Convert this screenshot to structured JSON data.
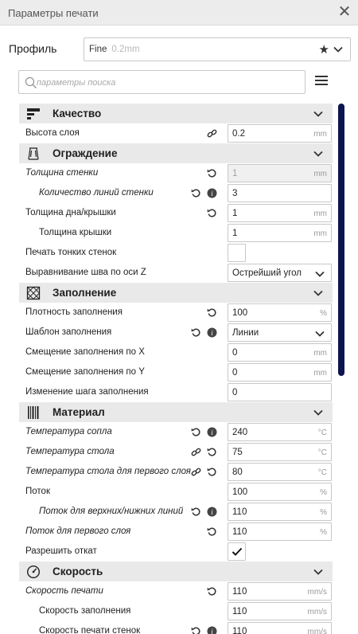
{
  "window": {
    "title": "Параметры печати"
  },
  "profile": {
    "label": "Профиль",
    "name": "Fine",
    "value": "0.2mm"
  },
  "search": {
    "placeholder": "параметры поиска"
  },
  "colors": {
    "accent": "#0e1450",
    "category_bg": "#e9e9e9"
  },
  "sections": [
    {
      "title": "Качество",
      "icon": "quality-icon",
      "rows": [
        {
          "label": "Высота слоя",
          "value": "0.2",
          "unit": "mm",
          "icons": [
            "link-icon"
          ]
        }
      ]
    },
    {
      "title": "Ограждение",
      "icon": "shell-icon",
      "rows": [
        {
          "label": "Толщина стенки",
          "value": "1",
          "unit": "mm",
          "icons": [
            "reset-icon"
          ]
        },
        {
          "label": "Количество линий стенки",
          "value": "3",
          "unit": "",
          "icons": [
            "reset-icon",
            "info-icon"
          ]
        },
        {
          "label": "Толщина дна/крышки",
          "value": "1",
          "unit": "mm",
          "icons": [
            "reset-icon"
          ]
        },
        {
          "label": "Толщина крышки",
          "value": "1",
          "unit": "mm"
        },
        {
          "label": "Печать тонких стенок",
          "checked": false
        },
        {
          "label": "Выравнивание шва по оси Z",
          "value": "Острейший угол"
        }
      ]
    },
    {
      "title": "Заполнение",
      "icon": "infill-icon",
      "rows": [
        {
          "label": "Плотность заполнения",
          "value": "100",
          "unit": "%",
          "icons": [
            "reset-icon"
          ]
        },
        {
          "label": "Шаблон заполнения",
          "value": "Линии",
          "icons": [
            "reset-icon",
            "info-icon"
          ]
        },
        {
          "label": "Смещение заполнения по X",
          "value": "0",
          "unit": "mm"
        },
        {
          "label": "Смещение заполнения по Y",
          "value": "0",
          "unit": "mm"
        },
        {
          "label": "Изменение шага заполнения",
          "value": "0",
          "unit": ""
        }
      ]
    },
    {
      "title": "Материал",
      "icon": "material-icon",
      "rows": [
        {
          "label": "Температура сопла",
          "value": "240",
          "unit": "°C",
          "icons": [
            "reset-icon",
            "info-icon"
          ]
        },
        {
          "label": "Температура стола",
          "value": "75",
          "unit": "°C",
          "icons": [
            "link-icon",
            "reset-icon"
          ]
        },
        {
          "label": "Температура стола для первого слоя",
          "value": "80",
          "unit": "°C",
          "icons": [
            "link-icon",
            "reset-icon"
          ]
        },
        {
          "label": "Поток",
          "value": "100",
          "unit": "%"
        },
        {
          "label": "Поток для верхних/нижних линий",
          "value": "110",
          "unit": "%",
          "icons": [
            "reset-icon",
            "info-icon"
          ]
        },
        {
          "label": "Поток для первого слоя",
          "value": "110",
          "unit": "%",
          "icons": [
            "reset-icon"
          ]
        },
        {
          "label": "Разрешить откат",
          "checked": true
        }
      ]
    },
    {
      "title": "Скорость",
      "icon": "speed-icon",
      "rows": [
        {
          "label": "Скорость печати",
          "value": "110",
          "unit": "mm/s",
          "icons": [
            "reset-icon"
          ]
        },
        {
          "label": "Скорость заполнения",
          "value": "110",
          "unit": "mm/s"
        },
        {
          "label": "Скорость печати стенок",
          "value": "110",
          "unit": "mm/s",
          "icons": [
            "reset-icon",
            "info-icon"
          ]
        }
      ]
    }
  ]
}
